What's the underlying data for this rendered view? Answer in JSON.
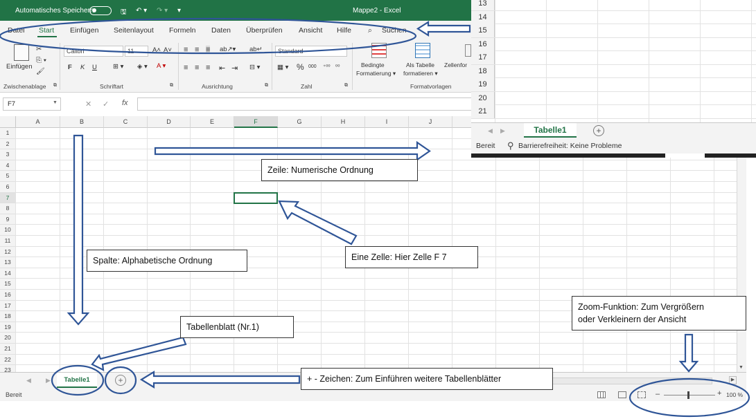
{
  "titlebar": {
    "autosave": "Automatisches Speichern",
    "document": "Mappe2 - Excel"
  },
  "menu": {
    "items": [
      {
        "label": "Datei",
        "active": false
      },
      {
        "label": "Start",
        "active": true
      },
      {
        "label": "Einfügen",
        "active": false
      },
      {
        "label": "Seitenlayout",
        "active": false
      },
      {
        "label": "Formeln",
        "active": false
      },
      {
        "label": "Daten",
        "active": false
      },
      {
        "label": "Überprüfen",
        "active": false
      },
      {
        "label": "Ansicht",
        "active": false
      },
      {
        "label": "Hilfe",
        "active": false
      }
    ],
    "search_label": "Suchen"
  },
  "ribbon": {
    "paste_label": "Einfügen",
    "font_name": "Calibri",
    "font_size": "11",
    "bold": "F",
    "italic": "K",
    "underline": "U",
    "number_format": "Standard",
    "percent": "%",
    "thousands": "000",
    "cond_format_line1": "Bedingte",
    "cond_format_line2": "Formatierung ▾",
    "table_line1": "Als Tabelle",
    "table_line2": "formatieren ▾",
    "cell_styles": "Zellenfor",
    "groups": {
      "clipboard": "Zwischenablage",
      "font": "Schriftart",
      "alignment": "Ausrichtung",
      "number": "Zahl",
      "styles": "Formatvorlagen"
    }
  },
  "formula_bar": {
    "name_box": "F7",
    "fx": "fx"
  },
  "grid": {
    "columns": [
      "A",
      "B",
      "C",
      "D",
      "E",
      "F",
      "G",
      "H",
      "I",
      "J"
    ],
    "rows": [
      "1",
      "2",
      "3",
      "4",
      "5",
      "6",
      "7",
      "8",
      "9",
      "10",
      "11",
      "12",
      "13",
      "14",
      "15",
      "16",
      "17",
      "18",
      "19",
      "20",
      "21",
      "22",
      "23"
    ],
    "selected_cell": "F7"
  },
  "sheet_tabs": {
    "active": "Tabelle1",
    "add": "+"
  },
  "status": {
    "ready": "Bereit",
    "zoom": "100 %"
  },
  "inset": {
    "rows": [
      "13",
      "14",
      "15",
      "16",
      "17",
      "18",
      "19",
      "20",
      "21"
    ],
    "tab": "Tabelle1",
    "status_ready": "Bereit",
    "accessibility": "Barrierefreiheit: Keine Probleme"
  },
  "annotations": {
    "row_order": "Zeile: Numerische Ordnung",
    "column_order": "Spalte: Alphabetische Ordnung",
    "cell": "Eine Zelle: Hier Zelle F 7",
    "sheet": "Tabellenblatt (Nr.1)",
    "plus": "+ -  Zeichen: Zum Einführen weitere Tabellenblätter",
    "zoom_line1": "Zoom-Funktion: Zum Vergrößern",
    "zoom_line2": "oder Verkleinern der Ansicht"
  },
  "colors": {
    "excel_green": "#217346",
    "annotation_blue": "#2f5597"
  }
}
